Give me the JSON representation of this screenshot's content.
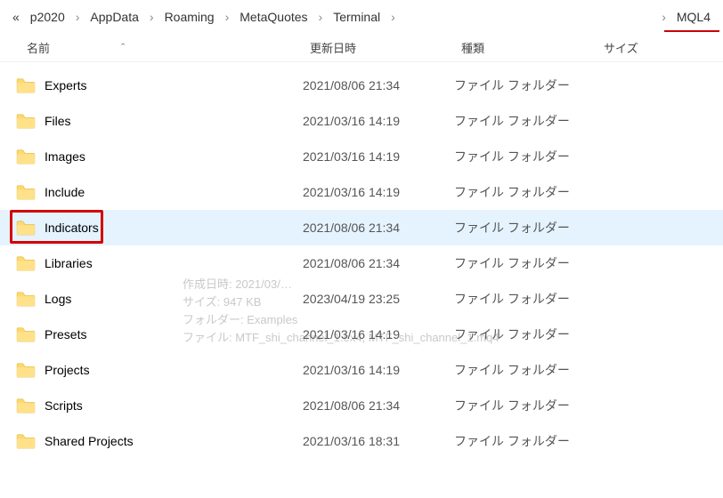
{
  "breadcrumb": {
    "more": "«",
    "items": [
      "p2020",
      "AppData",
      "Roaming",
      "MetaQuotes",
      "Terminal"
    ],
    "sep": "›",
    "last": "MQL4"
  },
  "columns": {
    "name": "名前",
    "sort_indicator": "ˆ",
    "date": "更新日時",
    "type": "種類",
    "size": "サイズ"
  },
  "files": [
    {
      "name": "Experts",
      "date": "2021/08/06 21:34",
      "type": "ファイル フォルダー",
      "selected": false,
      "highlighted": false
    },
    {
      "name": "Files",
      "date": "2021/03/16 14:19",
      "type": "ファイル フォルダー",
      "selected": false,
      "highlighted": false
    },
    {
      "name": "Images",
      "date": "2021/03/16 14:19",
      "type": "ファイル フォルダー",
      "selected": false,
      "highlighted": false
    },
    {
      "name": "Include",
      "date": "2021/03/16 14:19",
      "type": "ファイル フォルダー",
      "selected": false,
      "highlighted": false
    },
    {
      "name": "Indicators",
      "date": "2021/08/06 21:34",
      "type": "ファイル フォルダー",
      "selected": true,
      "highlighted": true
    },
    {
      "name": "Libraries",
      "date": "2021/08/06 21:34",
      "type": "ファイル フォルダー",
      "selected": false,
      "highlighted": false
    },
    {
      "name": "Logs",
      "date": "2023/04/19 23:25",
      "type": "ファイル フォルダー",
      "selected": false,
      "highlighted": false
    },
    {
      "name": "Presets",
      "date": "2021/03/16 14:19",
      "type": "ファイル フォルダー",
      "selected": false,
      "highlighted": false
    },
    {
      "name": "Projects",
      "date": "2021/03/16 14:19",
      "type": "ファイル フォルダー",
      "selected": false,
      "highlighted": false
    },
    {
      "name": "Scripts",
      "date": "2021/08/06 21:34",
      "type": "ファイル フォルダー",
      "selected": false,
      "highlighted": false
    },
    {
      "name": "Shared Projects",
      "date": "2021/03/16 18:31",
      "type": "ファイル フォルダー",
      "selected": false,
      "highlighted": false
    }
  ],
  "ghost_tooltip": {
    "l1": "作成日時: 2021/03/…",
    "l2": "サイズ: 947 KB",
    "l3": "フォルダー: Examples",
    "l4": "ファイル: MTF_shi_channel_1.ex4, MTF_shi_channel_1.mq4"
  }
}
